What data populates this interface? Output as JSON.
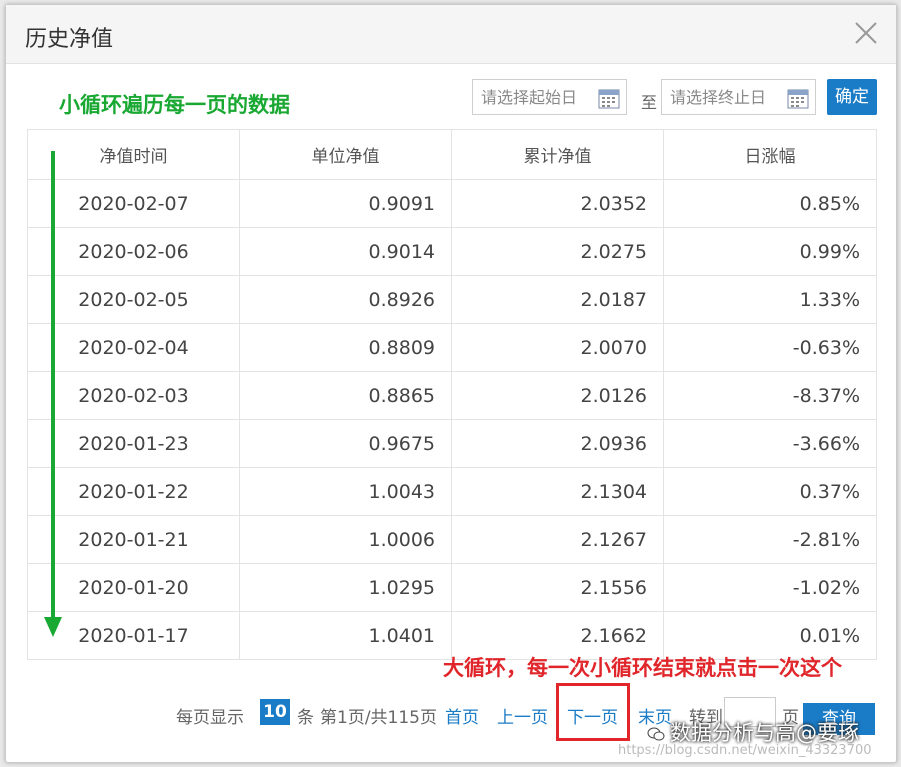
{
  "dialog": {
    "title": "历史净值",
    "close_icon": "close-icon"
  },
  "annotations": {
    "top": "小循环遍历每一页的数据",
    "bottom": "大循环，每一次小循环结束就点击一次这个"
  },
  "filter": {
    "start_placeholder": "请选择起始日",
    "to_label": "至",
    "end_placeholder": "请选择终止日",
    "confirm_label": "确定",
    "calendar_icon": "calendar-icon"
  },
  "table": {
    "headers": [
      "净值时间",
      "单位净值",
      "累计净值",
      "日涨幅"
    ],
    "rows": [
      {
        "date": "2020-02-07",
        "unit": "0.9091",
        "acc": "2.0352",
        "change": "0.85%",
        "dir": "up"
      },
      {
        "date": "2020-02-06",
        "unit": "0.9014",
        "acc": "2.0275",
        "change": "0.99%",
        "dir": "up"
      },
      {
        "date": "2020-02-05",
        "unit": "0.8926",
        "acc": "2.0187",
        "change": "1.33%",
        "dir": "up"
      },
      {
        "date": "2020-02-04",
        "unit": "0.8809",
        "acc": "2.0070",
        "change": "-0.63%",
        "dir": "down"
      },
      {
        "date": "2020-02-03",
        "unit": "0.8865",
        "acc": "2.0126",
        "change": "-8.37%",
        "dir": "down"
      },
      {
        "date": "2020-01-23",
        "unit": "0.9675",
        "acc": "2.0936",
        "change": "-3.66%",
        "dir": "down"
      },
      {
        "date": "2020-01-22",
        "unit": "1.0043",
        "acc": "2.1304",
        "change": "0.37%",
        "dir": "up"
      },
      {
        "date": "2020-01-21",
        "unit": "1.0006",
        "acc": "2.1267",
        "change": "-2.81%",
        "dir": "down"
      },
      {
        "date": "2020-01-20",
        "unit": "1.0295",
        "acc": "2.1556",
        "change": "-1.02%",
        "dir": "down"
      },
      {
        "date": "2020-01-17",
        "unit": "1.0401",
        "acc": "2.1662",
        "change": "0.01%",
        "dir": "up"
      }
    ]
  },
  "pager": {
    "per_page_label": "每页显示",
    "per_page_value": "10",
    "unit_label": "条",
    "page_info": "第1页/共115页",
    "first": "首页",
    "prev": "上一页",
    "next": "下一页",
    "last": "末页",
    "jump_label": "转到",
    "page_label": "页",
    "query": "查询"
  },
  "watermark": {
    "text": "数据分析与高@要琢",
    "url": "https://blog.csdn.net/weixin_43323700"
  },
  "colors": {
    "accent": "#1a7bc6",
    "positive": "#c8102e",
    "negative": "#1c9a2f",
    "annotation_green": "#19a832",
    "annotation_red": "#e0262b"
  }
}
